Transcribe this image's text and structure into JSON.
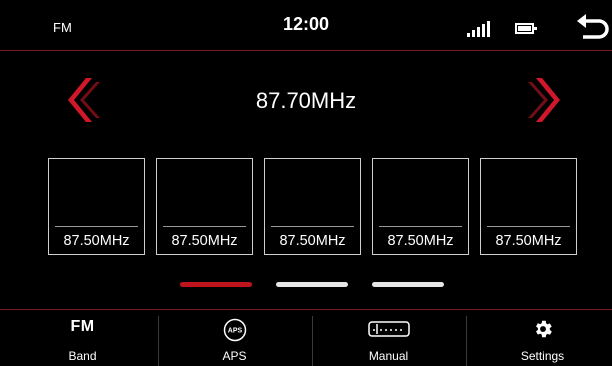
{
  "status": {
    "band": "FM",
    "time": "12:00",
    "icons": [
      "signal-icon",
      "battery-icon",
      "back-icon"
    ]
  },
  "tuner": {
    "frequency": "87.70MHz",
    "prev_icon": "chevron-left-icon",
    "next_icon": "chevron-right-icon"
  },
  "presets": [
    {
      "label": "87.50MHz"
    },
    {
      "label": "87.50MHz"
    },
    {
      "label": "87.50MHz"
    },
    {
      "label": "87.50MHz"
    },
    {
      "label": "87.50MHz"
    }
  ],
  "pager": {
    "pages": 3,
    "active": 1,
    "active_color": "#c0141c",
    "inactive_color": "#e6e6e6"
  },
  "bottom_bar": {
    "tabs": [
      {
        "icon_text": "FM",
        "label": "Band",
        "icon": "fm-icon"
      },
      {
        "icon_text": "APS",
        "label": "APS",
        "icon": "aps-icon"
      },
      {
        "label": "Manual",
        "icon": "manual-tune-icon"
      },
      {
        "label": "Settings",
        "icon": "gear-icon"
      }
    ]
  },
  "colors": {
    "accent": "#c0141c",
    "background": "#000000",
    "divider": "#7a1a1a"
  }
}
